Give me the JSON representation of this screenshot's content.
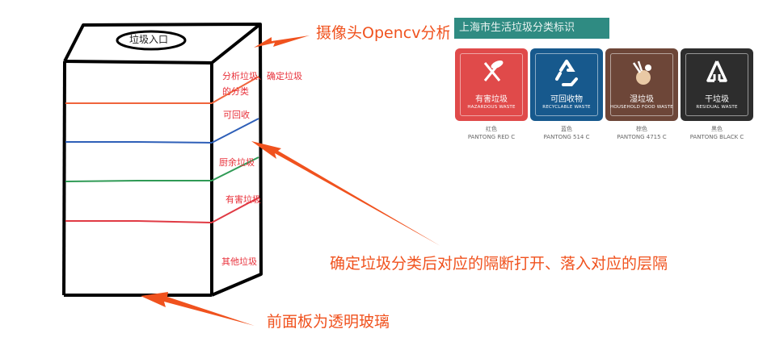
{
  "box": {
    "inlet_label": "垃圾入口",
    "layer_colors": [
      "#f0643c",
      "#2e5fb8",
      "#2f9a55",
      "#e03a44"
    ]
  },
  "side_labels": {
    "analyze": "分析垃圾、确定垃圾的分类",
    "recyclable": "可回收",
    "kitchen": "厨余垃圾",
    "hazardous": "有害垃圾",
    "other": "其他垃圾"
  },
  "annotations": {
    "camera": "摄像头Opencv分析垃圾",
    "partition": "确定垃圾分类后对应的隔断打开、落入对应的层隔",
    "front_panel": "前面板为透明玻璃"
  },
  "colors": {
    "arrow": "#f0521e",
    "chart_header": "#2f8b82"
  },
  "chart": {
    "title": "上海市生活垃圾分类标识",
    "bins": [
      {
        "cn": "有害垃圾",
        "en": "HAZARDOUS WASTE",
        "color_name": "红色",
        "pantone": "PANTONG RED C",
        "bg": "#e04a4a",
        "icon": "hazardous-icon"
      },
      {
        "cn": "可回收物",
        "en": "RECYCLABLE WASTE",
        "color_name": "蓝色",
        "pantone": "PANTONG 514 C",
        "bg": "#17598d",
        "icon": "recycle-icon"
      },
      {
        "cn": "湿垃圾",
        "en": "HOUSEHOLD FOOD WASTE",
        "color_name": "棕色",
        "pantone": "PANTONG 4715 C",
        "bg": "#6d4638",
        "icon": "food-waste-icon"
      },
      {
        "cn": "干垃圾",
        "en": "RESIDUAL WASTE",
        "color_name": "黑色",
        "pantone": "PANTONG BLACK C",
        "bg": "#2d2d2d",
        "icon": "residual-icon"
      }
    ]
  }
}
